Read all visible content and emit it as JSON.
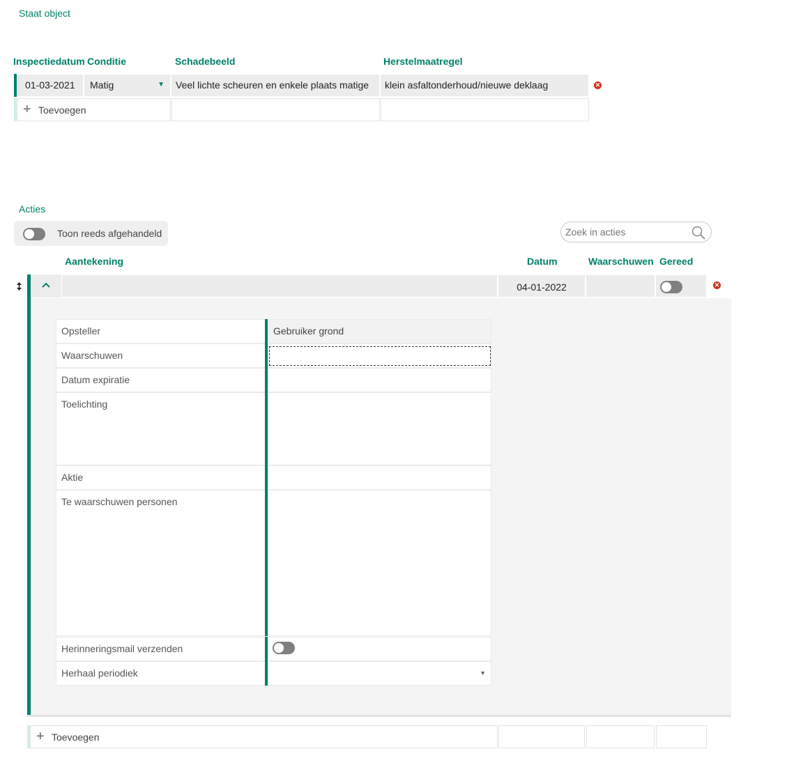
{
  "staat": {
    "title": "Staat object",
    "columns": {
      "inspectiedatum": "Inspectiedatum",
      "conditie": "Conditie",
      "schadebeeld": "Schadebeeld",
      "herstelmaatregel": "Herstelmaatregel"
    },
    "row": {
      "inspectiedatum": "01-03-2021",
      "conditie": "Matig",
      "schadebeeld": "Veel lichte scheuren en enkele plaats matige",
      "herstelmaatregel": "klein asfaltonderhoud/nieuwe deklaag"
    },
    "add_label": "Toevoegen"
  },
  "acties": {
    "title": "Acties",
    "toggle_label": "Toon reeds afgehandeld",
    "search_placeholder": "Zoek in acties",
    "columns": {
      "aantekening": "Aantekening",
      "datum": "Datum",
      "waarschuwen": "Waarschuwen",
      "gereed": "Gereed"
    },
    "row": {
      "aantekening": "",
      "datum": "04-01-2022",
      "waarschuwen": ""
    },
    "detail": {
      "opsteller_label": "Opsteller",
      "opsteller_value": "Gebruiker grond",
      "waarschuwen_label": "Waarschuwen",
      "datum_expiratie_label": "Datum expiratie",
      "toelichting_label": "Toelichting",
      "aktie_label": "Aktie",
      "te_waarschuwen_label": "Te waarschuwen personen",
      "herinneringsmail_label": "Herinneringsmail verzenden",
      "herhaal_label": "Herhaal periodiek"
    },
    "add_label": "Toevoegen"
  },
  "icons": {
    "remove": "remove-icon",
    "dropdown": "caret-down-icon",
    "collapse": "chevron-up-icon",
    "drag": "sort-handle-icon",
    "search": "search-icon",
    "add": "plus-icon"
  },
  "colors": {
    "accent": "#00806b",
    "remove": "#d0311b",
    "cell_bg": "#ececec"
  }
}
